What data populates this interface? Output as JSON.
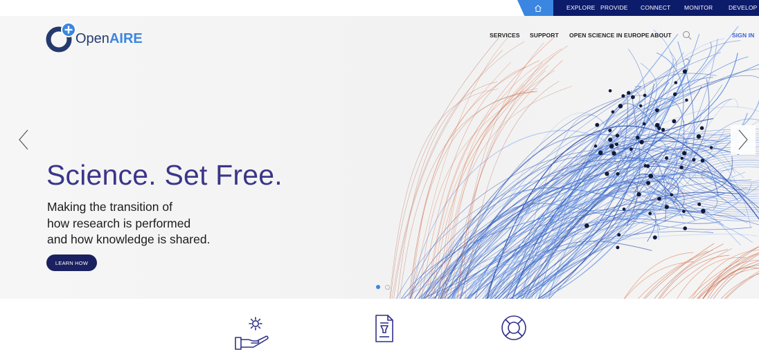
{
  "brand": {
    "logo_text_open": "Open",
    "logo_text_aire": "AIRE",
    "colors": {
      "navy": "#0d1b6b",
      "blue": "#3a86e0",
      "headline": "#3a3689",
      "button": "#1b2060"
    }
  },
  "topbar": {
    "home_icon": "home-icon",
    "links": [
      "EXPLORE",
      "PROVIDE",
      "CONNECT",
      "MONITOR",
      "DEVELOP"
    ]
  },
  "mainnav": {
    "items": [
      "SERVICES",
      "SUPPORT",
      "OPEN SCIENCE IN EUROPE",
      "ABOUT"
    ],
    "search_icon": "search-icon",
    "signin": "SIGN IN"
  },
  "hero": {
    "headline": "Science. Set Free.",
    "lines": [
      "Making the transition of",
      "how research is performed",
      "and how knowledge is shared."
    ],
    "button": "LEARN HOW",
    "slide_count": 2,
    "active_slide": 1,
    "prev_icon": "chevron-left-icon",
    "next_icon": "chevron-right-icon"
  },
  "features": {
    "icons": [
      "hand-gear-icon",
      "document-funnel-icon",
      "lifebuoy-icon"
    ]
  }
}
